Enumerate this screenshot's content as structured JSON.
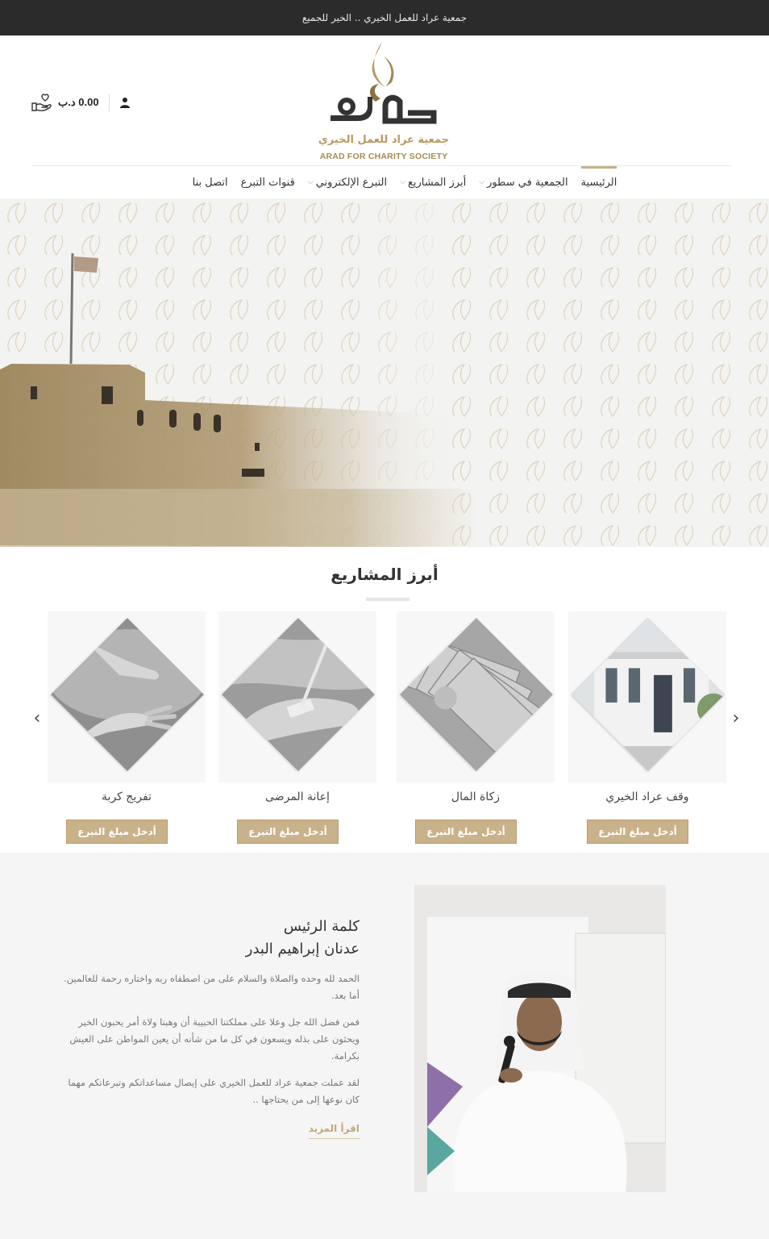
{
  "topbar": {
    "tagline": "جمعية عراد للعمل الخيري .. الخير للجميع"
  },
  "header": {
    "logo_text_ar": "جمعية عراد للعمل الخيري",
    "logo_text_en": "ARAD FOR CHARITY SOCIETY",
    "cart_amount": "0.00 د.ب",
    "cart_icon": "hand-heart-icon",
    "account_icon": "user-icon"
  },
  "nav": {
    "items": [
      {
        "label": "الرئيسية",
        "active": true,
        "dropdown": false
      },
      {
        "label": "الجمعية في سطور",
        "active": false,
        "dropdown": true
      },
      {
        "label": "أبرز المشاريع",
        "active": false,
        "dropdown": true
      },
      {
        "label": "التبرع الإلكتروني",
        "active": false,
        "dropdown": true
      },
      {
        "label": "قنوات التبرع",
        "active": false,
        "dropdown": false
      },
      {
        "label": "اتصل بنا",
        "active": false,
        "dropdown": false
      }
    ]
  },
  "projects": {
    "title": "أبرز المشاريع",
    "donate_label": "أدخل مبلغ التبرع",
    "items": [
      {
        "title": "وقف عراد الخيري",
        "image": "building-photo"
      },
      {
        "title": "زكاة المال",
        "image": "banknotes-photo"
      },
      {
        "title": "إعانة المرضى",
        "image": "iv-drip-hand-photo"
      },
      {
        "title": "تفريج كربة",
        "image": "reaching-hands-photo"
      }
    ]
  },
  "president": {
    "heading": "كلمة الرئيس",
    "name": "عدنان إبراهيم البدر",
    "paragraphs": [
      "الحمد لله وحده والصلاة والسلام على من اصطفاه ربه واختاره رحمة للعالمين. أما بعد.",
      "فمن فضل الله جل وعلا على مملكتنا الحبيبة أن وهبنا ولاة أمر يحبون الخير ويحثون على بذله ويسعون في كل ما من شأنه أن يعين المواطن على العيش بكرامة.",
      "لقد عملت جمعية عراد للعمل الخيري على إيصال مساعداتكم وتبرعاتكم مهما كان نوعها إلى من يحتاجها .."
    ],
    "read_more": "اقرأ المزيد"
  },
  "colors": {
    "gold": "#c9b28a",
    "dark_bar": "#2b2b2b",
    "logo_gold": "#b8995f"
  }
}
